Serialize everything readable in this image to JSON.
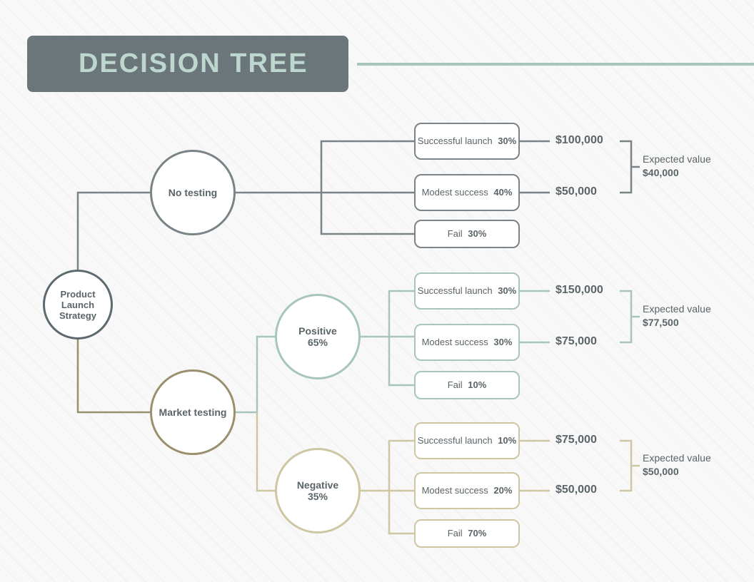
{
  "title": "DECISION TREE",
  "root": {
    "label": "Product Launch Strategy"
  },
  "branches": {
    "no_testing": {
      "label": "No testing",
      "outcomes": [
        {
          "name": "Successful launch",
          "pct": "30%",
          "value": "$100,000"
        },
        {
          "name": "Modest success",
          "pct": "40%",
          "value": "$50,000"
        },
        {
          "name": "Fail",
          "pct": "30%"
        }
      ],
      "expected_label": "Expected value",
      "expected_value": "$40,000"
    },
    "market_testing": {
      "label": "Market testing",
      "sub": {
        "positive": {
          "label": "Positive",
          "pct": "65%",
          "outcomes": [
            {
              "name": "Successful launch",
              "pct": "30%",
              "value": "$150,000"
            },
            {
              "name": "Modest success",
              "pct": "30%",
              "value": "$75,000"
            },
            {
              "name": "Fail",
              "pct": "10%"
            }
          ],
          "expected_label": "Expected value",
          "expected_value": "$77,500"
        },
        "negative": {
          "label": "Negative",
          "pct": "35%",
          "outcomes": [
            {
              "name": "Successful launch",
              "pct": "10%",
              "value": "$75,000"
            },
            {
              "name": "Modest success",
              "pct": "20%",
              "value": "$50,000"
            },
            {
              "name": "Fail",
              "pct": "70%"
            }
          ],
          "expected_label": "Expected value",
          "expected_value": "$50,000"
        }
      }
    }
  }
}
